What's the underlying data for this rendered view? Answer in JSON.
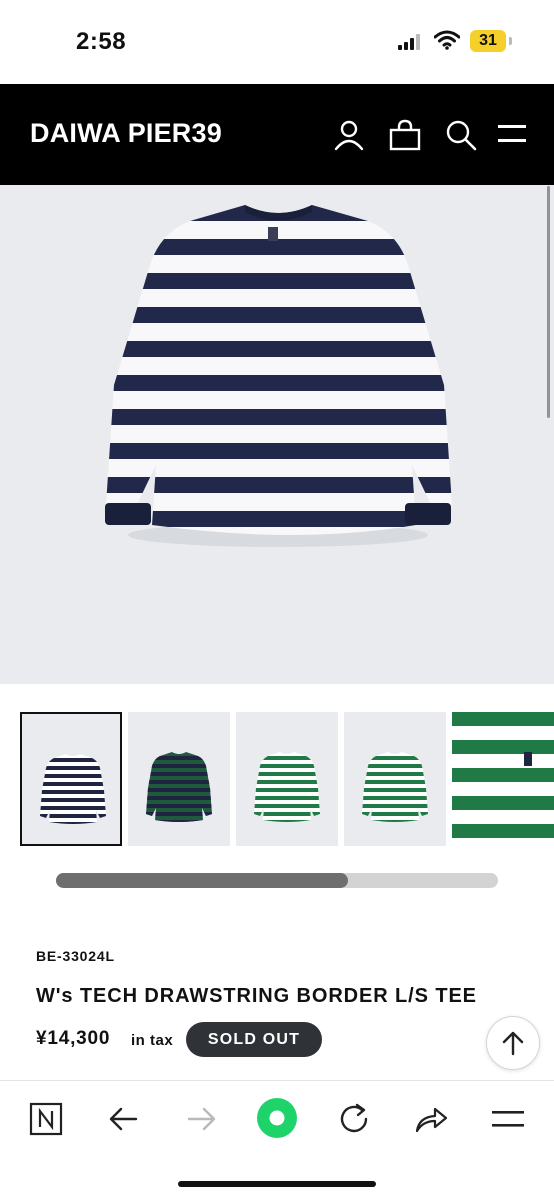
{
  "status_bar": {
    "time": "2:58",
    "battery": "31"
  },
  "header": {
    "brand": "DAIWA PIER39",
    "icons": [
      "user-icon",
      "bag-icon",
      "search-icon",
      "menu-icon"
    ]
  },
  "hero": {
    "product_image": "navy and white striped long sleeve tee"
  },
  "gallery": {
    "thumbnails": [
      {
        "label": "navy-white-stripe",
        "stripe": "#1f2540",
        "base": "#ffffff"
      },
      {
        "label": "green-navy-stripe",
        "stripe": "#1f2540",
        "base": "#1f5a3c"
      },
      {
        "label": "green-white-stripe",
        "stripe": "#1f7a46",
        "base": "#ffffff"
      },
      {
        "label": "green-white-stripe-back",
        "stripe": "#1f7a46",
        "base": "#ffffff"
      },
      {
        "label": "green-white-detail",
        "stripe": "#1f7a46",
        "base": "#ffffff"
      }
    ],
    "scroll_progress": 0.66
  },
  "product": {
    "sku": "BE-33024L",
    "name": "W's TECH DRAWSTRING BORDER L/S TEE",
    "price": "¥14,300",
    "tax_note": "in tax",
    "status": "SOLD OUT"
  },
  "colors": {
    "header_bg": "#000000",
    "badge_bg": "#2f3237",
    "browser_accent": "#1fd36b"
  },
  "browser_toolbar": [
    "n-icon",
    "back-icon",
    "forward-icon",
    "record-icon",
    "reload-icon",
    "share-icon",
    "menu-icon"
  ]
}
